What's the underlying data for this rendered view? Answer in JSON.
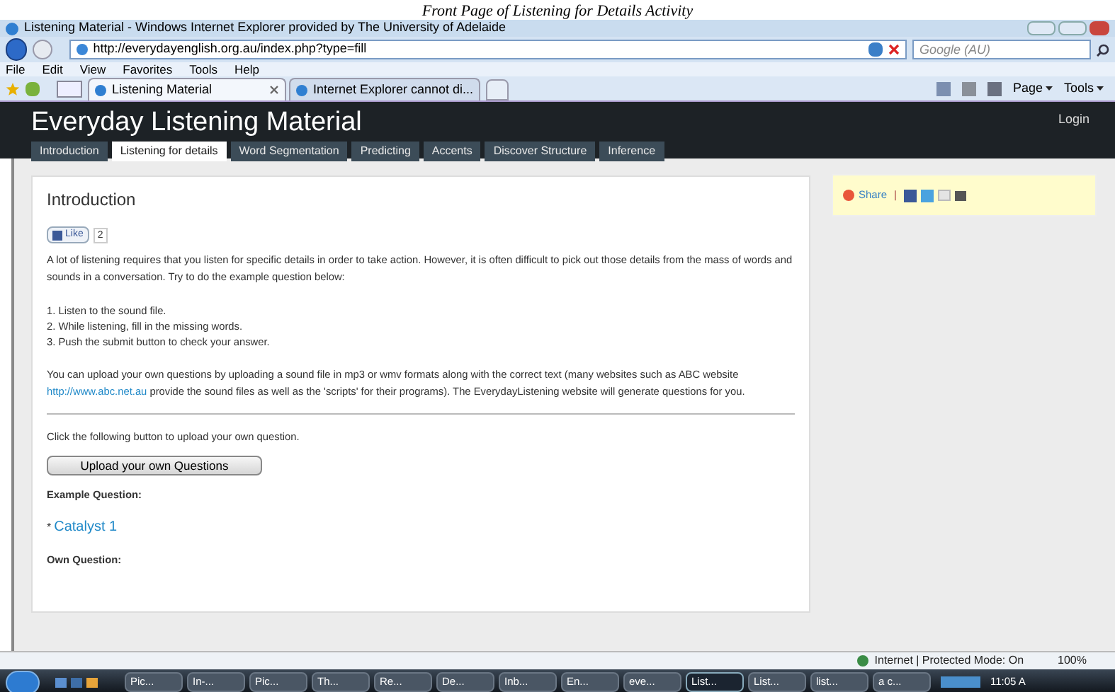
{
  "caption": "Front Page of Listening for Details Activity",
  "window": {
    "title": "Listening Material - Windows Internet Explorer provided by The University of Adelaide"
  },
  "address_bar": {
    "url": "http://everydayenglish.org.au/index.php?type=fill"
  },
  "search": {
    "placeholder": "Google (AU)"
  },
  "menu": [
    "File",
    "Edit",
    "View",
    "Favorites",
    "Tools",
    "Help"
  ],
  "browser_tabs": [
    {
      "label": "Listening Material",
      "selected": true
    },
    {
      "label": "Internet Explorer cannot di...",
      "selected": false
    }
  ],
  "command_bar": [
    "Page",
    "Tools"
  ],
  "site": {
    "title": "Everyday Listening Material",
    "login": "Login",
    "nav": [
      {
        "label": "Introduction",
        "selected": false
      },
      {
        "label": "Listening for details",
        "selected": true
      },
      {
        "label": "Word Segmentation",
        "selected": false
      },
      {
        "label": "Predicting",
        "selected": false
      },
      {
        "label": "Accents",
        "selected": false
      },
      {
        "label": "Discover Structure",
        "selected": false
      },
      {
        "label": "Inference",
        "selected": false
      }
    ]
  },
  "main": {
    "heading": "Introduction",
    "like": {
      "label": "Like",
      "count": "2"
    },
    "intro": "A lot of listening requires that you listen for specific details in order to take action. However, it is often difficult to pick out those details from the mass of words and sounds in a conversation. Try to do the example question below:",
    "steps": [
      "1. Listen to the sound file.",
      "2. While listening, fill in the missing words.",
      "3. Push the submit button to check your answer."
    ],
    "upload_text_before": "You can upload your own questions by uploading a sound file in mp3 or wmv formats along with the correct text (many websites such as ABC website",
    "upload_link": "http://www.abc.net.au",
    "upload_text_after": "provide the sound files as well as the 'scripts' for their programs). The EverydayListening website will generate questions for you.",
    "click_text": "Click the following button to upload your own question.",
    "upload_button": "Upload your own Questions",
    "example_label": "Example Question:",
    "example_bullet": "*",
    "example_link": "Catalyst 1",
    "own_label": "Own Question:"
  },
  "share": {
    "label": "Share",
    "separator": "|"
  },
  "status_bar": {
    "zone": "Internet | Protected Mode: On",
    "zoom": "100%"
  },
  "taskbar": {
    "items": [
      {
        "label": "Pic...",
        "selected": false
      },
      {
        "label": "In-...",
        "selected": false
      },
      {
        "label": "Pic...",
        "selected": false
      },
      {
        "label": "Th...",
        "selected": false
      },
      {
        "label": "Re...",
        "selected": false
      },
      {
        "label": "De...",
        "selected": false
      },
      {
        "label": "Inb...",
        "selected": false
      },
      {
        "label": "En...",
        "selected": false
      },
      {
        "label": "eve...",
        "selected": false
      },
      {
        "label": "List...",
        "selected": true
      },
      {
        "label": "List...",
        "selected": false
      },
      {
        "label": "list...",
        "selected": false
      },
      {
        "label": "a c...",
        "selected": false
      }
    ],
    "clock": "11:05 A"
  }
}
